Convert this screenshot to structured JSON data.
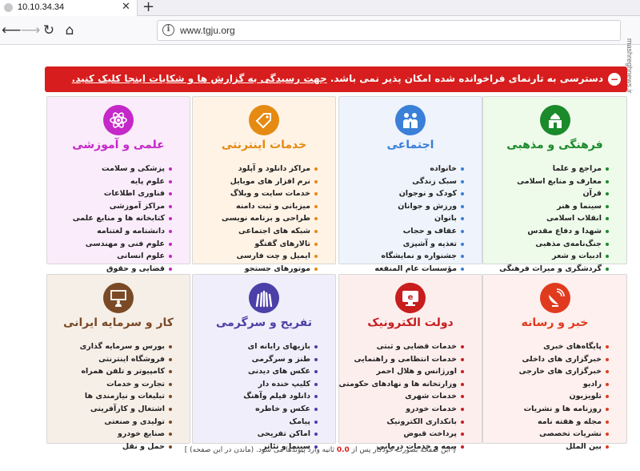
{
  "browser": {
    "tab_title": "10.10.34.34",
    "url": "www.tgju.org",
    "close_glyph": "✕",
    "new_tab_glyph": "+",
    "back_glyph": "⟵",
    "forward_glyph": "⟶",
    "reload_glyph": "↻",
    "home_glyph": "⌂",
    "info_glyph": "i"
  },
  "alert": {
    "text": "دسترسی به تارنمای فراخوانده شده امکان پذیر نمی باشد.",
    "link_text": "جهت رسیدگی به گزارش ها و شکایات اینجا کلیک کنید.",
    "icon": "−",
    "color": "#d71d1d"
  },
  "categories": [
    {
      "title": "فرهنگی و مذهبی",
      "color": "#1a8a2a",
      "bg": "#eefaea",
      "icon": "mosque-icon",
      "items": [
        "مراجع و علما",
        "معارف و منابع اسلامی",
        "قرآن",
        "سینما و هنر",
        "انقلاب اسلامی",
        "شهدا و دفاع مقدس",
        "جنگ‌نامه‌ی مذهبی",
        "ادبیات و شعر",
        "گردشگری و میراث فرهنگی"
      ]
    },
    {
      "title": "اجتماعی",
      "color": "#3a7fd8",
      "bg": "#eef3fc",
      "icon": "family-icon",
      "items": [
        "خانواده",
        "سبک زندگی",
        "کودک و نوجوان",
        "ورزش و جوانان",
        "بانوان",
        "عفاف و حجاب",
        "تغذیه و آشپزی",
        "جشنواره و نمایشگاه",
        "مؤسسات عام المنفعه"
      ]
    },
    {
      "title": "خدمات اینترنتی",
      "color": "#e58a12",
      "bg": "#fff3e6",
      "icon": "tag-icon",
      "items": [
        "مراکز دانلود و آپلود",
        "نرم افزار های موبایل",
        "خدمات سایت و وبلاگ",
        "میزبانی و ثبت دامنه",
        "طراحی و برنامه نویسی",
        "شبکه های اجتماعی",
        "تالارهای گفتگو",
        "ایمیل و چت فارسی",
        "موتورهای جستجو"
      ]
    },
    {
      "title": "علمی و آموزشی",
      "color": "#c428c8",
      "bg": "#fbecfb",
      "icon": "atom-icon",
      "items": [
        "پزشکی و سلامت",
        "علوم پایه",
        "فناوری اطلاعات",
        "مراکز آموزشی",
        "کتابخانه ها و منابع علمی",
        "دانشنامه و لغتنامه",
        "علوم فنی و مهندسی",
        "علوم انسانی",
        "قضایی و حقوق"
      ]
    },
    {
      "title": "خبر و رسانه",
      "color": "#e03b1f",
      "bg": "#fdf0ee",
      "icon": "satellite-dish-icon",
      "items": [
        "پایگاه‌های خبری",
        "خبرگزاری های داخلی",
        "خبرگزاری های خارجی",
        "رادیو",
        "تلویزیون",
        "روزنامه ها و نشریات",
        "مجله و هفته نامه",
        "نشریات تخصصی",
        "بین الملل"
      ]
    },
    {
      "title": "دولت الکترونیک",
      "color": "#c81e1e",
      "bg": "#fdeeee",
      "icon": "e-gov-icon",
      "items": [
        "خدمات قضایی و ثبتی",
        "خدمات انتظامی و راهنمایی",
        "اورژانس و هلال احمر",
        "وزارتخانه ها و نهادهای حکومتی",
        "خدمات شهری",
        "خدمات خودرو",
        "بانکداری الکترونیک",
        "پرداخت قبوض",
        "بیمه و خدمات درمانی"
      ]
    },
    {
      "title": "تفریح و سرگرمی",
      "color": "#4b3fa8",
      "bg": "#efeefa",
      "icon": "cheering-hands-icon",
      "items": [
        "بازیهای رایانه ای",
        "طنز و سرگرمی",
        "عکس های دیدنی",
        "کلیپ خنده دار",
        "دانلود فیلم وآهنگ",
        "عکس و خاطره",
        "پیامک",
        "اماکن تفریحی",
        "سینما و تئاتر"
      ]
    },
    {
      "title": "کار و سرمایه ایرانی",
      "color": "#7a4a26",
      "bg": "#f6efe8",
      "icon": "presentation-icon",
      "items": [
        "بورس و سرمایه گذاری",
        "فروشگاه اینترنتی",
        "کامپیوتر و تلفن همراه",
        "تجارت و خدمات",
        "تبلیغات و نیازمندی ها",
        "اشتغال و کارآفرینی",
        "تولیدی و صنعتی",
        "صنایع خودرو",
        "حمل و نقل"
      ]
    }
  ],
  "footer": {
    "prefix": "[ این صفحه بصورت خودکار پس از",
    "count": "0.0",
    "middle": "ثانیه وارد پیوندها می شود. (ماندن در این صفحه) ]"
  },
  "watermark": {
    "text": "mashreghnews.ir"
  }
}
